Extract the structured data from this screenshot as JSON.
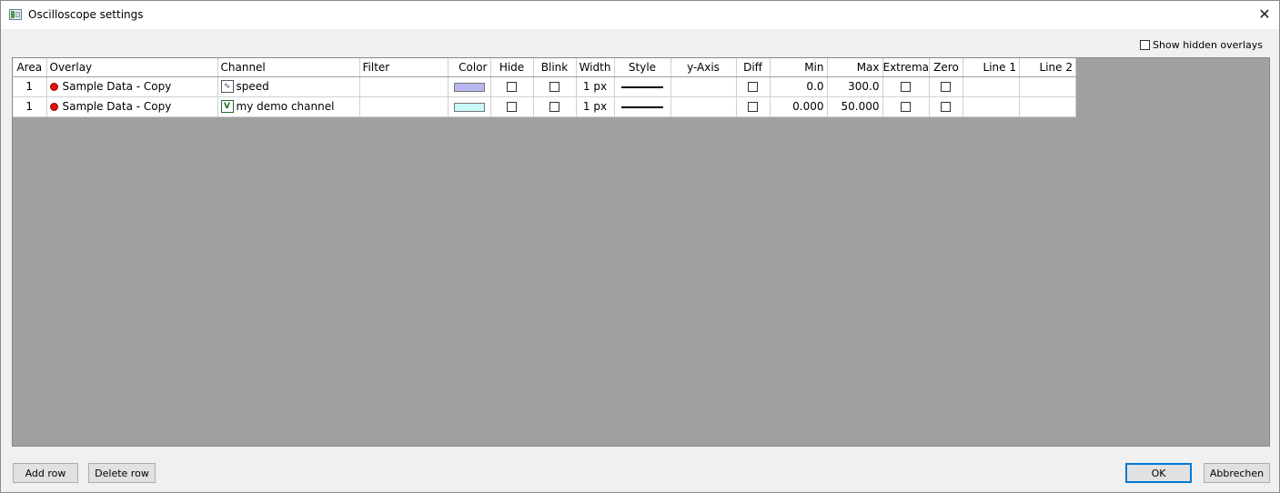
{
  "window": {
    "title": "Oscilloscope settings"
  },
  "options": {
    "show_hidden_label": "Show hidden overlays"
  },
  "table": {
    "headers": [
      "Area",
      "Overlay",
      "Channel",
      "Filter",
      "Color",
      "Hide",
      "Blink",
      "Width",
      "Style",
      "y-Axis",
      "Diff",
      "Min",
      "Max",
      "Extrema",
      "Zero",
      "Line 1",
      "Line 2"
    ],
    "rows": [
      {
        "area": "1",
        "overlay": "Sample Data - Copy",
        "channel": "speed",
        "channel_icon": "waveform-channel-icon",
        "filter": "",
        "color": "#b8b8f0",
        "width": "1 px",
        "y_axis": "",
        "min": "0.0",
        "max": "300.0",
        "line1": "",
        "line2": ""
      },
      {
        "area": "1",
        "overlay": "Sample Data - Copy",
        "channel": "my demo channel",
        "channel_icon": "variable-channel-icon",
        "filter": "",
        "color": "#c8f8f8",
        "width": "1 px",
        "y_axis": "",
        "min": "0.000",
        "max": "50.000",
        "line1": "",
        "line2": ""
      }
    ]
  },
  "buttons": {
    "add_row": "Add row",
    "delete_row": "Delete row",
    "ok": "OK",
    "cancel": "Abbrechen"
  },
  "colors": {
    "grid_background": "#a0a0a0",
    "overlay_dot": "#e01010",
    "default_button_border": "#0078d7"
  }
}
